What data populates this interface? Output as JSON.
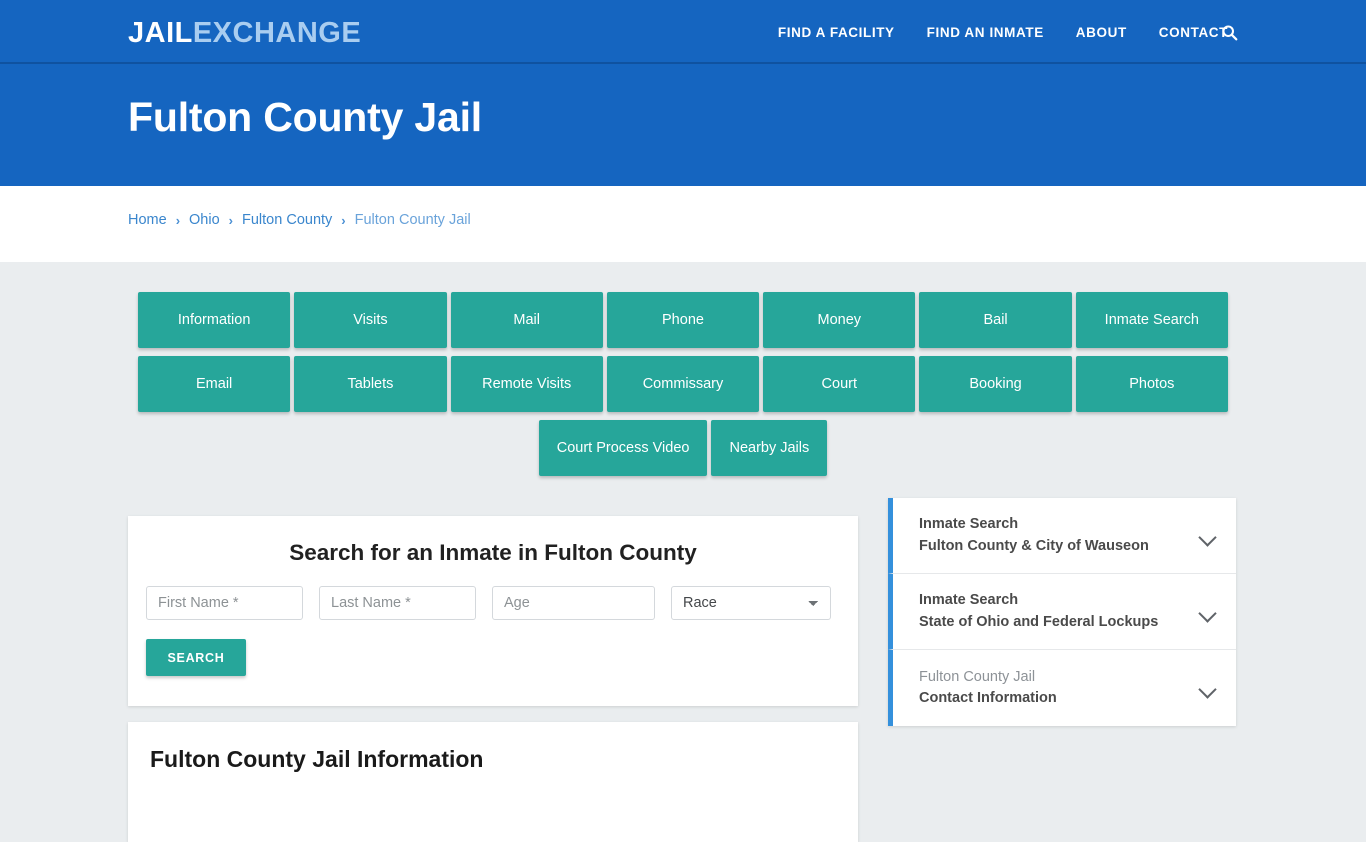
{
  "site": {
    "logo_primary": "JAIL",
    "logo_secondary": "EXCHANGE",
    "brand_blue": "#1565c0",
    "accent_teal": "#26a69a",
    "accent_link_blue": "#3490dc",
    "page_bg": "#eaedef"
  },
  "nav": {
    "items": [
      {
        "label": "FIND A FACILITY"
      },
      {
        "label": "FIND AN INMATE"
      },
      {
        "label": "ABOUT"
      },
      {
        "label": "CONTACT"
      }
    ],
    "search_icon": "search-icon"
  },
  "hero": {
    "title": "Fulton County Jail"
  },
  "breadcrumb": {
    "separator": "›",
    "items": [
      {
        "label": "Home",
        "current": false
      },
      {
        "label": "Ohio",
        "current": false
      },
      {
        "label": "Fulton County",
        "current": false
      },
      {
        "label": "Fulton County Jail",
        "current": true
      }
    ]
  },
  "button_grid": {
    "row1": [
      {
        "label": "Information"
      },
      {
        "label": "Visits"
      },
      {
        "label": "Mail"
      },
      {
        "label": "Phone"
      },
      {
        "label": "Money"
      },
      {
        "label": "Bail"
      },
      {
        "label": "Inmate Search"
      }
    ],
    "row2": [
      {
        "label": "Email"
      },
      {
        "label": "Tablets"
      },
      {
        "label": "Remote Visits"
      },
      {
        "label": "Commissary"
      },
      {
        "label": "Court"
      },
      {
        "label": "Booking"
      },
      {
        "label": "Photos"
      }
    ],
    "row3": [
      {
        "label": "Court Process Video"
      },
      {
        "label": "Nearby Jails"
      }
    ]
  },
  "search_form": {
    "heading": "Search for an Inmate in Fulton County",
    "first_name": {
      "placeholder": "First Name *",
      "value": ""
    },
    "last_name": {
      "placeholder": "Last Name *",
      "value": ""
    },
    "age": {
      "placeholder": "Age",
      "value": ""
    },
    "race": {
      "selected": "Race",
      "options": [
        "Race"
      ]
    },
    "submit_label": "SEARCH"
  },
  "accordion": {
    "items": [
      {
        "line1": "Inmate Search",
        "line2": "Fulton County & City of Wauseon",
        "line1_muted": false,
        "icon": "chevron-down-icon"
      },
      {
        "line1": "Inmate Search",
        "line2": "State of Ohio and Federal Lockups",
        "line1_muted": false,
        "icon": "chevron-down-icon"
      },
      {
        "line1": "Fulton County Jail",
        "line2": "Contact Information",
        "line1_muted": true,
        "icon": "chevron-down-icon"
      }
    ]
  },
  "info_card": {
    "heading": "Fulton County Jail Information"
  }
}
